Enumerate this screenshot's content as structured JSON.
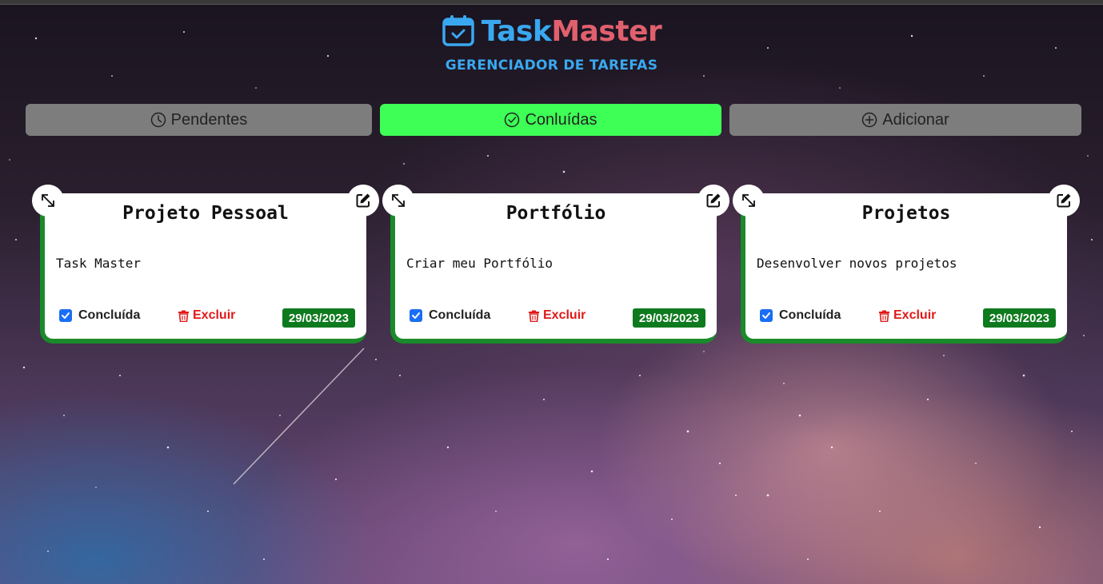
{
  "brand": {
    "name_part1": "Task",
    "name_part2": "Master",
    "subtitle": "GERENCIADOR DE TAREFAS",
    "icon": "calendar-check-icon",
    "color_task": "#3aa8f0",
    "color_master": "#e0606e"
  },
  "tabs": [
    {
      "label": "Pendentes",
      "icon": "clock-icon",
      "active": false
    },
    {
      "label": "Conluídas",
      "icon": "check-circle-icon",
      "active": true
    },
    {
      "label": "Adicionar",
      "icon": "plus-circle-icon",
      "active": false
    }
  ],
  "colors": {
    "active_tab": "#3dff55",
    "inactive_tab": "#7d7d7d",
    "card_accent": "#1a8a2a",
    "date_badge": "#0e7a1e",
    "delete": "#e01a1a",
    "checkbox": "#1a6ef5"
  },
  "tasks": [
    {
      "title": "Projeto Pessoal",
      "description": "Task Master",
      "done_label": "Concluída",
      "delete_label": "Excluir",
      "date": "29/03/2023",
      "done": true
    },
    {
      "title": "Portfólio",
      "description": "Criar meu Portfólio",
      "done_label": "Concluída",
      "delete_label": "Excluir",
      "date": "29/03/2023",
      "done": true
    },
    {
      "title": "Projetos",
      "description": "Desenvolver novos projetos",
      "done_label": "Concluída",
      "delete_label": "Excluir",
      "date": "29/03/2023",
      "done": true
    }
  ]
}
